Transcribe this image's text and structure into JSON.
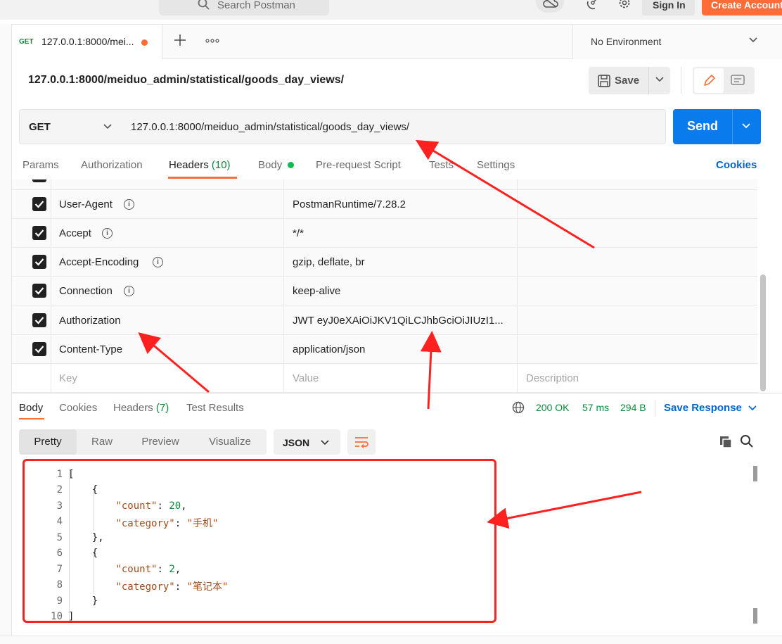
{
  "topbar": {
    "search_placeholder": "Search Postman",
    "sign_in": "Sign In",
    "create_account": "Create Account"
  },
  "tabs": {
    "active": {
      "method": "GET",
      "name": "127.0.0.1:8000/mei..."
    },
    "environment": "No Environment"
  },
  "request": {
    "title": "127.0.0.1:8000/meiduo_admin/statistical/goods_day_views/",
    "save_label": "Save",
    "method": "GET",
    "url": "127.0.0.1:8000/meiduo_admin/statistical/goods_day_views/",
    "send_label": "Send"
  },
  "request_tabs": {
    "params": "Params",
    "authorization": "Authorization",
    "headers": "Headers",
    "headers_count": "(10)",
    "body": "Body",
    "prerequest": "Pre-request Script",
    "tests": "Tests",
    "settings": "Settings",
    "cookies": "Cookies"
  },
  "headers": {
    "rows": [
      {
        "key": "User-Agent",
        "value": "PostmanRuntime/7.28.2"
      },
      {
        "key": "Accept",
        "value": "*/*"
      },
      {
        "key": "Accept-Encoding",
        "value": "gzip, deflate, br"
      },
      {
        "key": "Connection",
        "value": "keep-alive"
      },
      {
        "key": "Authorization",
        "value": "JWT eyJ0eXAiOiJKV1QiLCJhbGciOiJIUzI1..."
      },
      {
        "key": "Content-Type",
        "value": "application/json"
      }
    ],
    "key_placeholder": "Key",
    "value_placeholder": "Value",
    "description_placeholder": "Description"
  },
  "response": {
    "tabs": {
      "body": "Body",
      "cookies": "Cookies",
      "headers": "Headers",
      "headers_count": "(7)",
      "test_results": "Test Results"
    },
    "status": "200 OK",
    "time": "57 ms",
    "size": "294 B",
    "save_response": "Save Response",
    "views": {
      "pretty": "Pretty",
      "raw": "Raw",
      "preview": "Preview",
      "visualize": "Visualize"
    },
    "format": "JSON",
    "line_numbers": [
      "1",
      "2",
      "3",
      "4",
      "5",
      "6",
      "7",
      "8",
      "9",
      "10"
    ],
    "body": [
      {
        "count": 20,
        "category": "手机"
      },
      {
        "count": 2,
        "category": "笔记本"
      }
    ],
    "code": {
      "open_bracket": "[",
      "open_brace": "{",
      "close_brace_comma": "},",
      "close_brace": "}",
      "close_bracket": "]",
      "count_key": "\"count\"",
      "category_key": "\"category\"",
      "item0_count": "20",
      "item0_category": "\"手机\"",
      "item1_count": "2",
      "item1_category": "\"笔记本\""
    }
  },
  "colors": {
    "brand": "#ff6c37",
    "send": "#097bed",
    "annotation": "#ff2020",
    "status_ok": "#0b8a3c",
    "link": "#0265d2"
  }
}
